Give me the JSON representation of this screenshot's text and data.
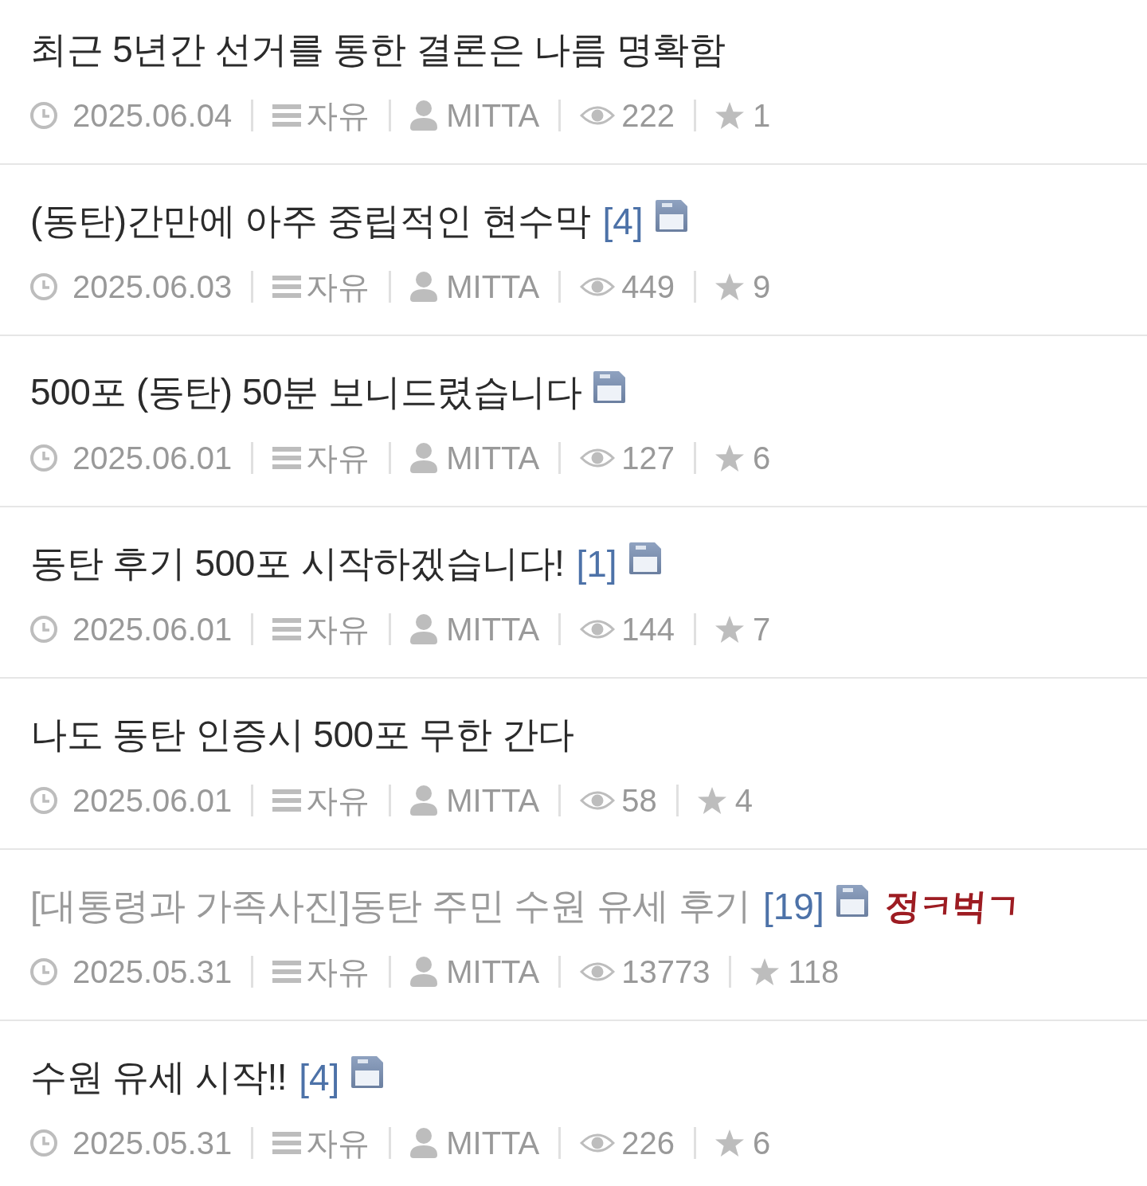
{
  "posts": [
    {
      "title": "최근 5년간 선거를 통한 결론은 나름 명확함",
      "has_image": false,
      "visited": false,
      "date": "2025.06.04",
      "category": "자유",
      "author": "MITTA",
      "views": "222",
      "recommends": "1"
    },
    {
      "title": "(동탄)간만에 아주 중립적인 현수막",
      "comments": "[4]",
      "has_image": true,
      "visited": false,
      "date": "2025.06.03",
      "category": "자유",
      "author": "MITTA",
      "views": "449",
      "recommends": "9"
    },
    {
      "title": "500포 (동탄) 50분 보니드렸습니다",
      "has_image": true,
      "visited": false,
      "date": "2025.06.01",
      "category": "자유",
      "author": "MITTA",
      "views": "127",
      "recommends": "6"
    },
    {
      "title": "동탄 후기 500포 시작하겠습니다!",
      "comments": "[1]",
      "has_image": true,
      "visited": false,
      "date": "2025.06.01",
      "category": "자유",
      "author": "MITTA",
      "views": "144",
      "recommends": "7"
    },
    {
      "title": "나도 동탄 인증시 500포 무한 간다",
      "has_image": false,
      "visited": false,
      "date": "2025.06.01",
      "category": "자유",
      "author": "MITTA",
      "views": "58",
      "recommends": "4"
    },
    {
      "title": "[대통령과 가족사진]동탄 주민 수원 유세 후기",
      "comments": "[19]",
      "has_image": true,
      "badge": "정ㅋ벅ㄱ",
      "visited": true,
      "date": "2025.05.31",
      "category": "자유",
      "author": "MITTA",
      "views": "13773",
      "recommends": "118"
    },
    {
      "title": "수원 유세 시작!!",
      "comments": "[4]",
      "has_image": true,
      "visited": false,
      "date": "2025.05.31",
      "category": "자유",
      "author": "MITTA",
      "views": "226",
      "recommends": "6"
    }
  ]
}
